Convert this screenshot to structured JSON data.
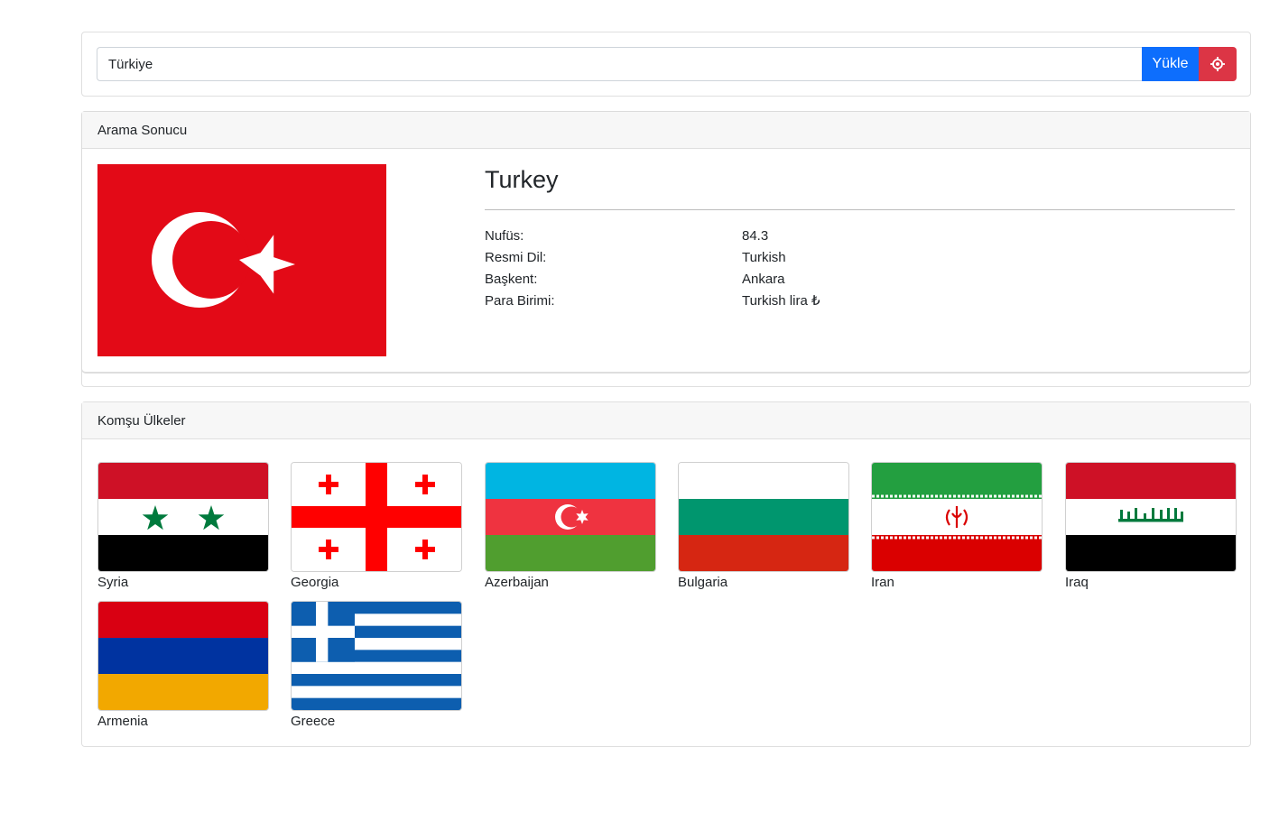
{
  "search": {
    "value": "Türkiye",
    "load_label": "Yükle",
    "locate_icon": "crosshair-icon"
  },
  "result": {
    "header": "Arama Sonucu",
    "country_name": "Turkey",
    "rows": [
      {
        "label": "Nufüs:",
        "value": "84.3"
      },
      {
        "label": "Resmi Dil:",
        "value": "Turkish"
      },
      {
        "label": "Başkent:",
        "value": "Ankara"
      },
      {
        "label": "Para Birimi:",
        "value": "Turkish lira ₺"
      }
    ]
  },
  "neighbors": {
    "header": "Komşu Ülkeler",
    "items": [
      {
        "name": "Syria"
      },
      {
        "name": "Georgia"
      },
      {
        "name": "Azerbaijan"
      },
      {
        "name": "Bulgaria"
      },
      {
        "name": "Iran"
      },
      {
        "name": "Iraq"
      },
      {
        "name": "Armenia"
      },
      {
        "name": "Greece"
      }
    ]
  },
  "colors": {
    "primary": "#0d6efd",
    "danger": "#dc3545",
    "turkey_red": "#e30a17"
  }
}
